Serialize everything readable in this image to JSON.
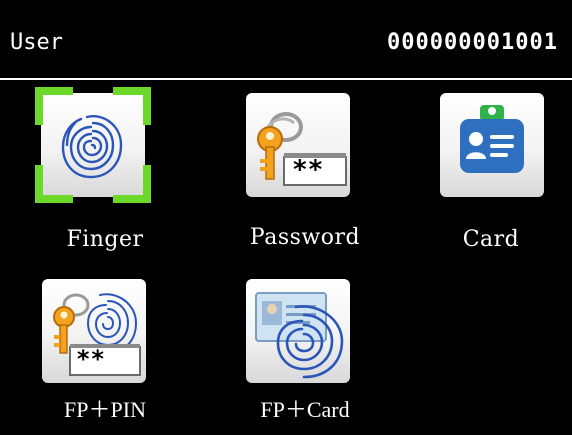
{
  "header": {
    "title": "User",
    "user_id": "000000001001"
  },
  "menu": {
    "items": [
      {
        "id": "finger",
        "label": "Finger",
        "icon": "fingerprint-icon",
        "selected": true
      },
      {
        "id": "password",
        "label": "Password",
        "icon": "key-password-icon",
        "mask": "**"
      },
      {
        "id": "card",
        "label": "Card",
        "icon": "id-card-icon"
      },
      {
        "id": "fp-pin",
        "label": "FP＋PIN",
        "icon": "fingerprint-key-icon",
        "mask": "**"
      },
      {
        "id": "fp-card",
        "label": "FP＋Card",
        "icon": "fingerprint-card-icon"
      }
    ]
  },
  "colors": {
    "background": "#000000",
    "text": "#ffffff",
    "selection": "#6cd92a",
    "fingerprint": "#2b56b8",
    "card": "#2f6fc0"
  }
}
